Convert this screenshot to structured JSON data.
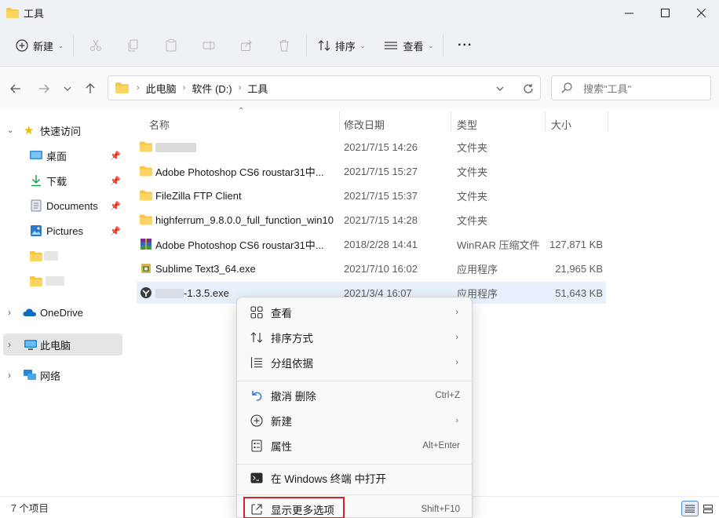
{
  "window": {
    "title": "工具",
    "colors": {
      "accent": "#0067c0",
      "folder": "#f8c54a",
      "highlight": "#d2232a"
    }
  },
  "commandbar": {
    "new_label": "新建",
    "sort_label": "排序",
    "view_label": "查看",
    "more_label": "···"
  },
  "address": {
    "crumbs": [
      "此电脑",
      "软件 (D:)",
      "工具"
    ],
    "search_placeholder": "搜索\"工具\""
  },
  "sidebar": {
    "quick_access": "快速访问",
    "items": [
      {
        "label": "桌面",
        "icon": "desktop-icon",
        "pinned": true
      },
      {
        "label": "下载",
        "icon": "download-icon",
        "pinned": true
      },
      {
        "label": "Documents",
        "icon": "document-icon",
        "pinned": true
      },
      {
        "label": "Pictures",
        "icon": "pictures-icon",
        "pinned": true
      }
    ],
    "onedrive": "OneDrive",
    "this_pc": "此电脑",
    "network": "网络"
  },
  "columns": {
    "name": "名称",
    "date": "修改日期",
    "type": "类型",
    "size": "大小"
  },
  "files": [
    {
      "name": "",
      "date": "2021/7/15 14:26",
      "type": "文件夹",
      "size": "",
      "icon": "folder-icon"
    },
    {
      "name": "Adobe Photoshop CS6 roustar31中...",
      "date": "2021/7/15 15:27",
      "type": "文件夹",
      "size": "",
      "icon": "folder-icon"
    },
    {
      "name": "FileZilla FTP Client",
      "date": "2021/7/15 15:37",
      "type": "文件夹",
      "size": "",
      "icon": "folder-icon"
    },
    {
      "name": "highferrum_9.8.0.0_full_function_win10",
      "date": "2021/7/15 14:28",
      "type": "文件夹",
      "size": "",
      "icon": "folder-icon"
    },
    {
      "name": "Adobe Photoshop CS6 roustar31中...",
      "date": "2018/2/28 14:41",
      "type": "WinRAR 压缩文件",
      "size": "127,871 KB",
      "icon": "winrar-icon"
    },
    {
      "name": "Sublime Text3_64.exe",
      "date": "2021/7/10 16:02",
      "type": "应用程序",
      "size": "21,965 KB",
      "icon": "installer-icon"
    },
    {
      "name": "-1.3.5.exe",
      "date": "2021/3/4 16:07",
      "type": "应用程序",
      "size": "51,643 KB",
      "icon": "app-icon"
    }
  ],
  "context_menu": {
    "view": "查看",
    "sort": "排序方式",
    "group": "分组依据",
    "undo": "撤消 删除",
    "undo_shortcut": "Ctrl+Z",
    "new": "新建",
    "properties": "属性",
    "properties_shortcut": "Alt+Enter",
    "open_terminal": "在 Windows 终端 中打开",
    "more_options": "显示更多选项",
    "more_options_shortcut": "Shift+F10"
  },
  "status": {
    "count": "7 个项目"
  }
}
